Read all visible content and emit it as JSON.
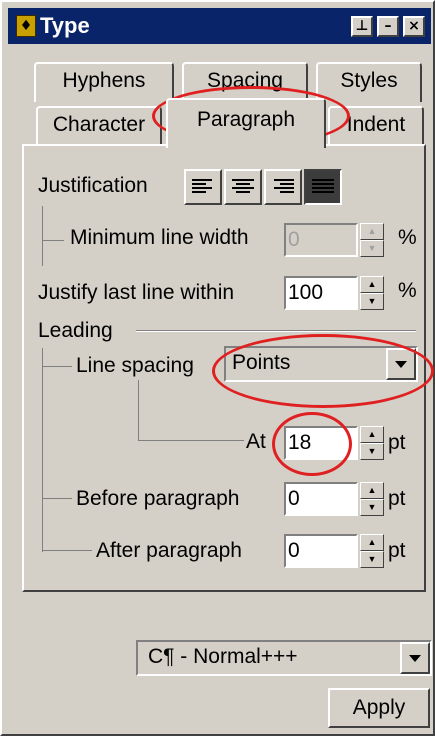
{
  "window": {
    "title": "Type",
    "icon": "app-logo-icon",
    "controls": [
      "pin",
      "minimize",
      "close"
    ]
  },
  "tabs": {
    "row1": [
      "Hyphens",
      "Spacing",
      "Styles"
    ],
    "row2": [
      "Character",
      "Paragraph",
      "Indent"
    ],
    "active": "Paragraph"
  },
  "justification": {
    "label": "Justification",
    "options": [
      "align-left",
      "align-center",
      "align-right",
      "justify"
    ],
    "selected": "justify"
  },
  "min_line_width": {
    "label": "Minimum line width",
    "value": "0",
    "unit": "%",
    "enabled": false
  },
  "justify_last_line": {
    "label": "Justify last line within",
    "value": "100",
    "unit": "%"
  },
  "leading": {
    "label": "Leading",
    "line_spacing": {
      "label": "Line spacing",
      "value": "Points"
    },
    "at": {
      "label": "At",
      "value": "18",
      "unit": "pt"
    }
  },
  "before_paragraph": {
    "label": "Before paragraph",
    "value": "0",
    "unit": "pt"
  },
  "after_paragraph": {
    "label": "After paragraph",
    "value": "0",
    "unit": "pt"
  },
  "style_select": {
    "value": "C¶ - Normal+++"
  },
  "apply_label": "Apply",
  "colors": {
    "title_bar": "#0a246a",
    "face": "#d4d0c8",
    "annotation_ring": "#e02020"
  }
}
